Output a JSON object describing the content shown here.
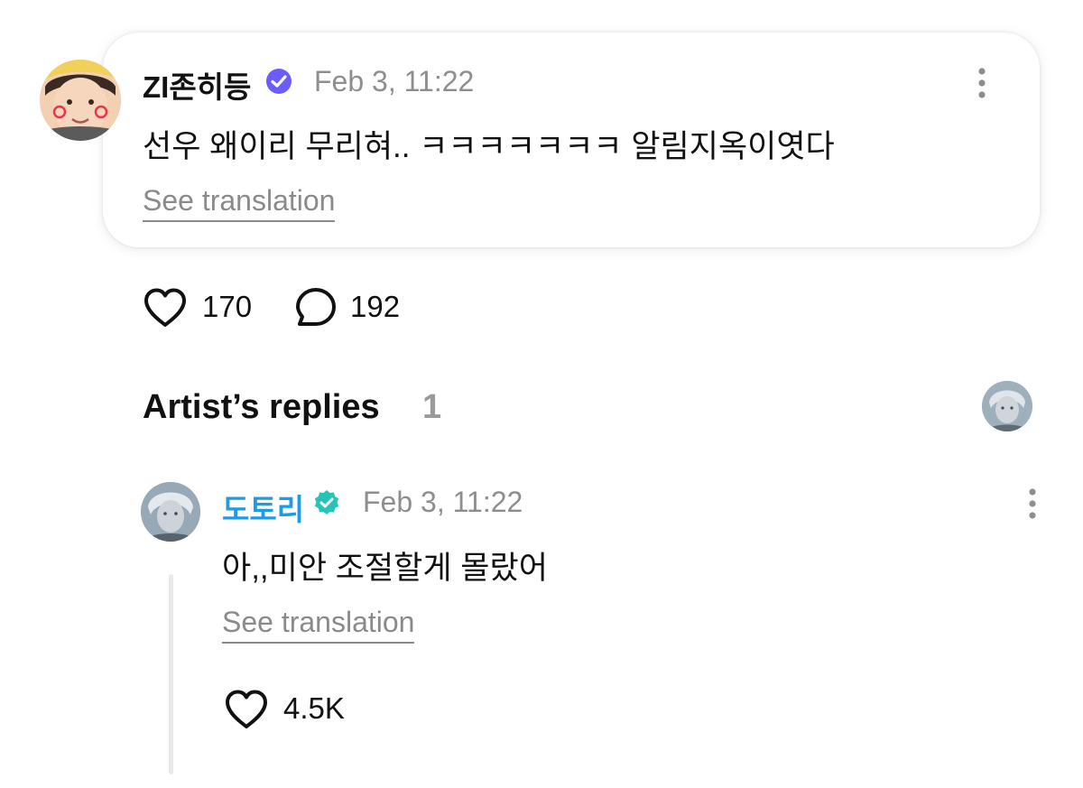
{
  "post": {
    "username": "ZI존히등",
    "date": "Feb 3, 11:22",
    "text": "선우 왜이리 무리혀.. ㅋㅋㅋㅋㅋㅋㅋ 알림지옥이엿다",
    "translate_label": "See translation",
    "likes": "170",
    "comments": "192",
    "icons": {
      "verified": "verified-badge-icon",
      "more": "more-vertical-icon",
      "like": "heart-icon",
      "comment": "comment-bubble-icon"
    },
    "colors": {
      "verified_badge": "#6a5cff"
    }
  },
  "artist_replies": {
    "title": "Artist’s replies",
    "count": "1"
  },
  "reply": {
    "username": "도토리",
    "date": "Feb 3, 11:22",
    "text": "아,,미안 조절할게 몰랐어",
    "translate_label": "See translation",
    "likes": "4.5K",
    "colors": {
      "username": "#1f9be6",
      "verified_badge": "#27c3b8"
    }
  }
}
